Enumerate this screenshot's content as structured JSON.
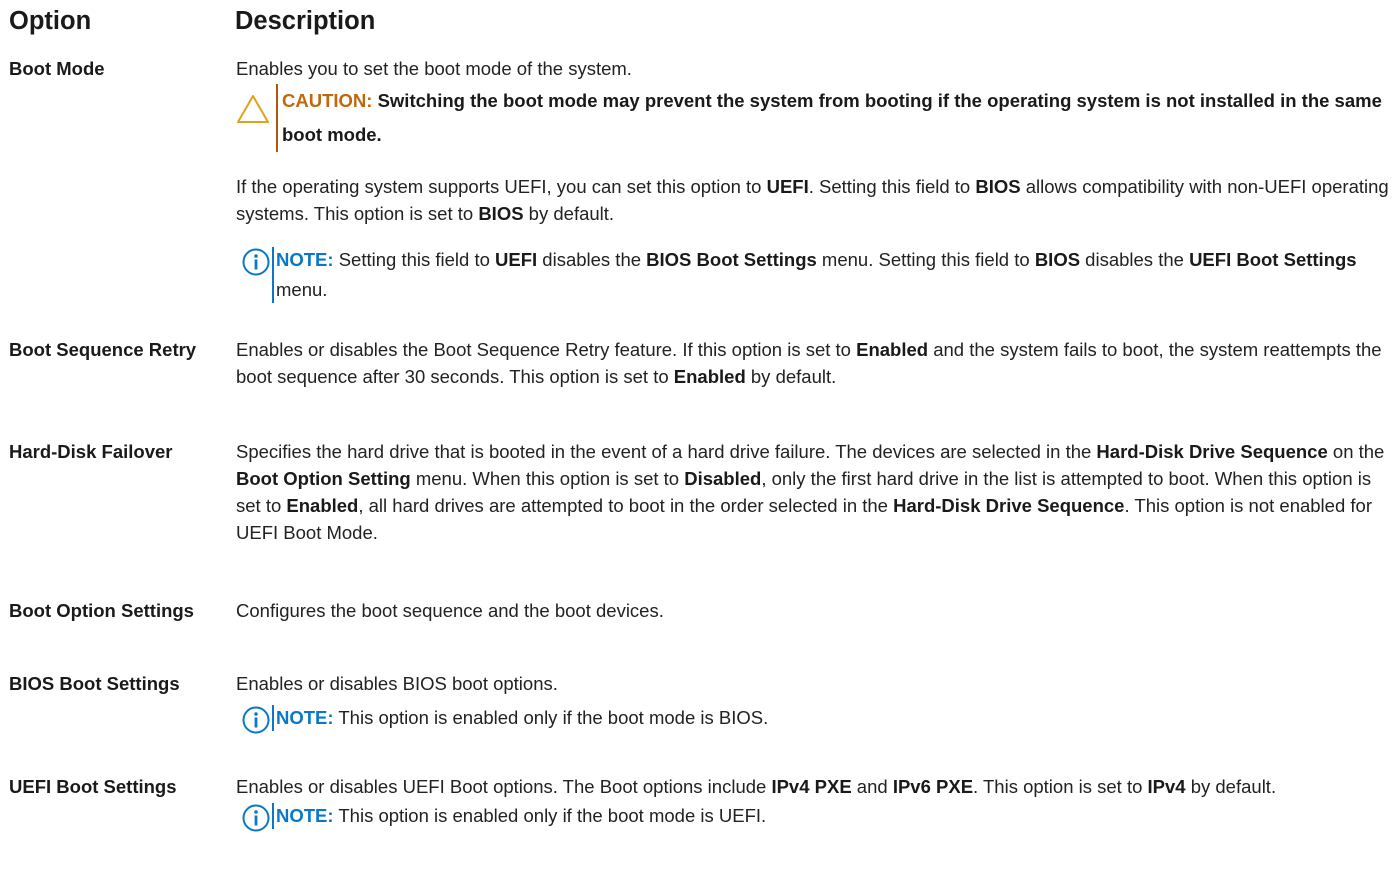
{
  "headers": {
    "option": "Option",
    "description": "Description"
  },
  "rows": [
    {
      "option": "Boot Mode",
      "desc1": "Enables you to set the boot mode of the system.",
      "caution": {
        "label": "CAUTION:",
        "text": "Switching the boot mode may prevent the system from booting if the operating system is not installed in the same boot mode."
      },
      "p2": {
        "a": "If the operating system supports UEFI, you can set this option to ",
        "b1": "UEFI",
        "c": ". Setting this field to ",
        "b2": "BIOS",
        "d": " allows compatibility with non-UEFI operating systems. This option is set to ",
        "b3": "BIOS",
        "e": " by default."
      },
      "note": {
        "label": "NOTE:",
        "a": " Setting this field to ",
        "b1": "UEFI",
        "c": " disables the ",
        "b2": "BIOS Boot Settings",
        "d": " menu. Setting this field to ",
        "b3": "BIOS",
        "e": " disables the ",
        "b4": "UEFI Boot Settings",
        "f": " menu."
      }
    },
    {
      "option": "Boot Sequence Retry",
      "desc": {
        "a": "Enables or disables the Boot Sequence Retry feature. If this option is set to ",
        "b1": "Enabled",
        "c": " and the system fails to boot, the system reattempts the boot sequence after 30 seconds. This option is set to ",
        "b2": "Enabled",
        "d": " by default."
      }
    },
    {
      "option": "Hard-Disk Failover",
      "desc": {
        "a": "Specifies the hard drive that is booted in the event of a hard drive failure. The devices are selected in the ",
        "b1": "Hard-Disk Drive Sequence",
        "c": " on the ",
        "b2": "Boot Option Setting",
        "d": " menu. When this option is set to ",
        "b3": "Disabled",
        "e": ", only the first hard drive in the list is attempted to boot. When this option is set to ",
        "b4": "Enabled",
        "f": ", all hard drives are attempted to boot in the order selected in the ",
        "b5": "Hard-Disk Drive Sequence",
        "g": ". This option is not enabled for UEFI Boot Mode."
      }
    },
    {
      "option": "Boot Option Settings",
      "desc": "Configures the boot sequence and the boot devices."
    },
    {
      "option": "BIOS Boot Settings",
      "desc": "Enables or disables BIOS boot options.",
      "note": {
        "label": "NOTE:",
        "text": " This option is enabled only if the boot mode is BIOS."
      }
    },
    {
      "option": "UEFI Boot Settings",
      "desc": {
        "a": "Enables or disables UEFI Boot options. The Boot options include ",
        "b1": "IPv4 PXE",
        "c": " and ",
        "b2": "IPv6 PXE",
        "d": ". This option is set to ",
        "b3": "IPv4",
        "e": " by default."
      },
      "note": {
        "label": "NOTE:",
        "text": " This option is enabled only if the boot mode is UEFI."
      }
    }
  ],
  "icons": {
    "caution": "caution-triangle-icon",
    "note": "info-circle-icon"
  },
  "colors": {
    "caution": "#c06810",
    "note": "#0a77c9"
  }
}
